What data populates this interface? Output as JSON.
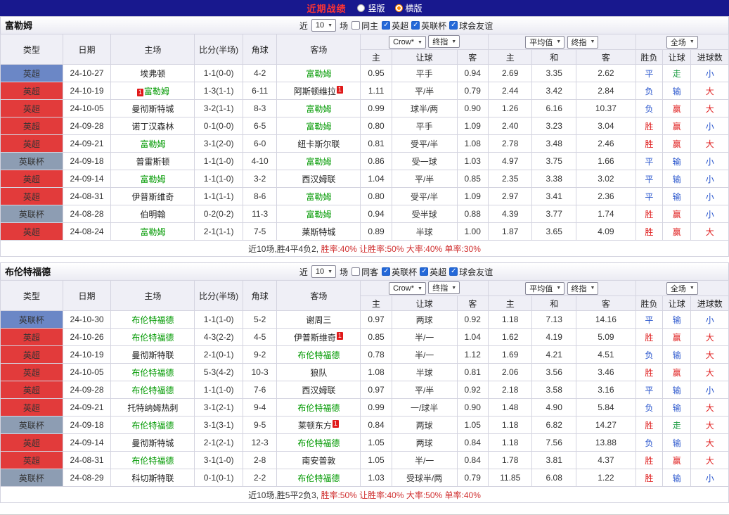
{
  "topbar": {
    "title": "近期战绩",
    "radios": [
      {
        "name": "vertical",
        "label": "竖版",
        "selected": false
      },
      {
        "name": "horizontal",
        "label": "横版",
        "selected": true
      }
    ]
  },
  "icons": {
    "arrow": "▼",
    "check": "✓"
  },
  "colors": {
    "navy_bar": "#18188e",
    "title_red": "#ff3333",
    "league": {
      "recent": "#6b87c6",
      "premier": "#e23b3b",
      "cup": "#8d9db3"
    },
    "result_map": {
      "胜": "#e02222",
      "赢": "#e02222",
      "大": "#e02222",
      "负": "#2653cc",
      "输": "#2653cc",
      "小": "#2653cc",
      "平": "#2653cc",
      "走": "#1f9e45"
    },
    "focus_team": "#009900",
    "score": "#d03a3a",
    "rates": "#d03030"
  },
  "headers": {
    "cols": [
      "类型",
      "日期",
      "主场",
      "比分(半场)",
      "角球",
      "客场"
    ],
    "asian": [
      "主",
      "让球",
      "客"
    ],
    "euro": [
      "主",
      "和",
      "客"
    ],
    "res": [
      "胜负",
      "让球",
      "进球数"
    ]
  },
  "sections": [
    {
      "team": "富勒姆",
      "filters": {
        "recent_label": "近",
        "count": "10",
        "games_label": "场",
        "same_label": "同主",
        "same_checked": false,
        "leagues": [
          {
            "label": "英超",
            "checked": true
          },
          {
            "label": "英联杯",
            "checked": true
          },
          {
            "label": "球会友谊",
            "checked": true
          }
        ]
      },
      "dropdowns": {
        "book": "Crow*",
        "book_time": "终指",
        "avg": "平均值",
        "avg_time": "终指",
        "scope": "全场"
      },
      "rows": [
        {
          "league": "英超",
          "league_color": "recent",
          "date": "24-10-27",
          "home": "埃弗顿",
          "home_focus": false,
          "score": "1-1(0-0)",
          "corners": "4-2",
          "away": "富勒姆",
          "away_focus": true,
          "ah_home": "0.95",
          "ah_line": "平手",
          "ah_away": "0.94",
          "eu_home": "2.69",
          "eu_draw": "3.35",
          "eu_away": "2.62",
          "res_outcome": "平",
          "res_handicap": "走",
          "res_goals": "小"
        },
        {
          "league": "英超",
          "league_color": "premier",
          "date": "24-10-19",
          "home": "富勒姆",
          "home_focus": true,
          "home_card": "1",
          "home_card_pos": "before",
          "score": "1-3(1-1)",
          "corners": "6-11",
          "away": "阿斯顿维拉",
          "away_focus": false,
          "away_card": "1",
          "away_card_pos": "after",
          "ah_home": "1.11",
          "ah_line": "平/半",
          "ah_away": "0.79",
          "eu_home": "2.44",
          "eu_draw": "3.42",
          "eu_away": "2.84",
          "res_outcome": "负",
          "res_handicap": "输",
          "res_goals": "大"
        },
        {
          "league": "英超",
          "league_color": "premier",
          "date": "24-10-05",
          "home": "曼彻斯特城",
          "home_focus": false,
          "score": "3-2(1-1)",
          "corners": "8-3",
          "away": "富勒姆",
          "away_focus": true,
          "ah_home": "0.99",
          "ah_line": "球半/两",
          "ah_away": "0.90",
          "eu_home": "1.26",
          "eu_draw": "6.16",
          "eu_away": "10.37",
          "res_outcome": "负",
          "res_handicap": "赢",
          "res_goals": "大"
        },
        {
          "league": "英超",
          "league_color": "premier",
          "date": "24-09-28",
          "home": "诺丁汉森林",
          "home_focus": false,
          "score": "0-1(0-0)",
          "corners": "6-5",
          "away": "富勒姆",
          "away_focus": true,
          "ah_home": "0.80",
          "ah_line": "平手",
          "ah_away": "1.09",
          "eu_home": "2.40",
          "eu_draw": "3.23",
          "eu_away": "3.04",
          "res_outcome": "胜",
          "res_handicap": "赢",
          "res_goals": "小"
        },
        {
          "league": "英超",
          "league_color": "premier",
          "date": "24-09-21",
          "home": "富勒姆",
          "home_focus": true,
          "score": "3-1(2-0)",
          "corners": "6-0",
          "away": "纽卡斯尔联",
          "away_focus": false,
          "ah_home": "0.81",
          "ah_line": "受平/半",
          "ah_away": "1.08",
          "eu_home": "2.78",
          "eu_draw": "3.48",
          "eu_away": "2.46",
          "res_outcome": "胜",
          "res_handicap": "赢",
          "res_goals": "大"
        },
        {
          "league": "英联杯",
          "league_color": "cup",
          "date": "24-09-18",
          "home": "普雷斯顿",
          "home_focus": false,
          "score": "1-1(1-0)",
          "corners": "4-10",
          "away": "富勒姆",
          "away_focus": true,
          "ah_home": "0.86",
          "ah_line": "受一球",
          "ah_away": "1.03",
          "eu_home": "4.97",
          "eu_draw": "3.75",
          "eu_away": "1.66",
          "res_outcome": "平",
          "res_handicap": "输",
          "res_goals": "小"
        },
        {
          "league": "英超",
          "league_color": "premier",
          "date": "24-09-14",
          "home": "富勒姆",
          "home_focus": true,
          "score": "1-1(1-0)",
          "corners": "3-2",
          "away": "西汉姆联",
          "away_focus": false,
          "ah_home": "1.04",
          "ah_line": "平/半",
          "ah_away": "0.85",
          "eu_home": "2.35",
          "eu_draw": "3.38",
          "eu_away": "3.02",
          "res_outcome": "平",
          "res_handicap": "输",
          "res_goals": "小"
        },
        {
          "league": "英超",
          "league_color": "premier",
          "date": "24-08-31",
          "home": "伊普斯维奇",
          "home_focus": false,
          "score": "1-1(1-1)",
          "corners": "8-6",
          "away": "富勒姆",
          "away_focus": true,
          "ah_home": "0.80",
          "ah_line": "受平/半",
          "ah_away": "1.09",
          "eu_home": "2.97",
          "eu_draw": "3.41",
          "eu_away": "2.36",
          "res_outcome": "平",
          "res_handicap": "输",
          "res_goals": "小"
        },
        {
          "league": "英联杯",
          "league_color": "cup",
          "date": "24-08-28",
          "home": "伯明翰",
          "home_focus": false,
          "score": "0-2(0-2)",
          "corners": "11-3",
          "away": "富勒姆",
          "away_focus": true,
          "ah_home": "0.94",
          "ah_line": "受半球",
          "ah_away": "0.88",
          "eu_home": "4.39",
          "eu_draw": "3.77",
          "eu_away": "1.74",
          "res_outcome": "胜",
          "res_handicap": "赢",
          "res_goals": "小"
        },
        {
          "league": "英超",
          "league_color": "premier",
          "date": "24-08-24",
          "home": "富勒姆",
          "home_focus": true,
          "score": "2-1(1-1)",
          "corners": "7-5",
          "away": "莱斯特城",
          "away_focus": false,
          "ah_home": "0.89",
          "ah_line": "半球",
          "ah_away": "1.00",
          "eu_home": "1.87",
          "eu_draw": "3.65",
          "eu_away": "4.09",
          "res_outcome": "胜",
          "res_handicap": "赢",
          "res_goals": "大"
        }
      ],
      "summary": {
        "prefix": "近10场,胜4平4负2,",
        "rates": " 胜率:40% 让胜率:50% 大率:40% 单率:30%"
      }
    },
    {
      "team": "布伦特福德",
      "filters": {
        "recent_label": "近",
        "count": "10",
        "games_label": "场",
        "same_label": "同客",
        "same_checked": false,
        "leagues": [
          {
            "label": "英联杯",
            "checked": true
          },
          {
            "label": "英超",
            "checked": true
          },
          {
            "label": "球会友谊",
            "checked": true
          }
        ]
      },
      "dropdowns": {
        "book": "Crow*",
        "book_time": "终指",
        "avg": "平均值",
        "avg_time": "终指",
        "scope": "全场"
      },
      "rows": [
        {
          "league": "英联杯",
          "league_color": "recent",
          "date": "24-10-30",
          "home": "布伦特福德",
          "home_focus": true,
          "score": "1-1(1-0)",
          "corners": "5-2",
          "away": "谢周三",
          "away_focus": false,
          "ah_home": "0.97",
          "ah_line": "两球",
          "ah_away": "0.92",
          "eu_home": "1.18",
          "eu_draw": "7.13",
          "eu_away": "14.16",
          "res_outcome": "平",
          "res_handicap": "输",
          "res_goals": "小"
        },
        {
          "league": "英超",
          "league_color": "premier",
          "date": "24-10-26",
          "home": "布伦特福德",
          "home_focus": true,
          "score": "4-3(2-2)",
          "corners": "4-5",
          "away": "伊普斯维奇",
          "away_focus": false,
          "away_card": "1",
          "away_card_pos": "after",
          "ah_home": "0.85",
          "ah_line": "半/一",
          "ah_away": "1.04",
          "eu_home": "1.62",
          "eu_draw": "4.19",
          "eu_away": "5.09",
          "res_outcome": "胜",
          "res_handicap": "赢",
          "res_goals": "大"
        },
        {
          "league": "英超",
          "league_color": "premier",
          "date": "24-10-19",
          "home": "曼彻斯特联",
          "home_focus": false,
          "score": "2-1(0-1)",
          "corners": "9-2",
          "away": "布伦特福德",
          "away_focus": true,
          "ah_home": "0.78",
          "ah_line": "半/一",
          "ah_away": "1.12",
          "eu_home": "1.69",
          "eu_draw": "4.21",
          "eu_away": "4.51",
          "res_outcome": "负",
          "res_handicap": "输",
          "res_goals": "大"
        },
        {
          "league": "英超",
          "league_color": "premier",
          "date": "24-10-05",
          "home": "布伦特福德",
          "home_focus": true,
          "score": "5-3(4-2)",
          "corners": "10-3",
          "away": "狼队",
          "away_focus": false,
          "ah_home": "1.08",
          "ah_line": "半球",
          "ah_away": "0.81",
          "eu_home": "2.06",
          "eu_draw": "3.56",
          "eu_away": "3.46",
          "res_outcome": "胜",
          "res_handicap": "赢",
          "res_goals": "大"
        },
        {
          "league": "英超",
          "league_color": "premier",
          "date": "24-09-28",
          "home": "布伦特福德",
          "home_focus": true,
          "score": "1-1(1-0)",
          "corners": "7-6",
          "away": "西汉姆联",
          "away_focus": false,
          "ah_home": "0.97",
          "ah_line": "平/半",
          "ah_away": "0.92",
          "eu_home": "2.18",
          "eu_draw": "3.58",
          "eu_away": "3.16",
          "res_outcome": "平",
          "res_handicap": "输",
          "res_goals": "小"
        },
        {
          "league": "英超",
          "league_color": "premier",
          "date": "24-09-21",
          "home": "托特纳姆热刺",
          "home_focus": false,
          "score": "3-1(2-1)",
          "corners": "9-4",
          "away": "布伦特福德",
          "away_focus": true,
          "ah_home": "0.99",
          "ah_line": "一/球半",
          "ah_away": "0.90",
          "eu_home": "1.48",
          "eu_draw": "4.90",
          "eu_away": "5.84",
          "res_outcome": "负",
          "res_handicap": "输",
          "res_goals": "大"
        },
        {
          "league": "英联杯",
          "league_color": "cup",
          "date": "24-09-18",
          "home": "布伦特福德",
          "home_focus": true,
          "score": "3-1(3-1)",
          "corners": "9-5",
          "away": "莱顿东方",
          "away_focus": false,
          "away_card": "1",
          "away_card_pos": "after",
          "ah_home": "0.84",
          "ah_line": "两球",
          "ah_away": "1.05",
          "eu_home": "1.18",
          "eu_draw": "6.82",
          "eu_away": "14.27",
          "res_outcome": "胜",
          "res_handicap": "走",
          "res_goals": "大"
        },
        {
          "league": "英超",
          "league_color": "premier",
          "date": "24-09-14",
          "home": "曼彻斯特城",
          "home_focus": false,
          "score": "2-1(2-1)",
          "corners": "12-3",
          "away": "布伦特福德",
          "away_focus": true,
          "ah_home": "1.05",
          "ah_line": "两球",
          "ah_away": "0.84",
          "eu_home": "1.18",
          "eu_draw": "7.56",
          "eu_away": "13.88",
          "res_outcome": "负",
          "res_handicap": "输",
          "res_goals": "大"
        },
        {
          "league": "英超",
          "league_color": "premier",
          "date": "24-08-31",
          "home": "布伦特福德",
          "home_focus": true,
          "score": "3-1(1-0)",
          "corners": "2-8",
          "away": "南安普敦",
          "away_focus": false,
          "ah_home": "1.05",
          "ah_line": "半/一",
          "ah_away": "0.84",
          "eu_home": "1.78",
          "eu_draw": "3.81",
          "eu_away": "4.37",
          "res_outcome": "胜",
          "res_handicap": "赢",
          "res_goals": "大"
        },
        {
          "league": "英联杯",
          "league_color": "cup",
          "date": "24-08-29",
          "home": "科切斯特联",
          "home_focus": false,
          "score": "0-1(0-1)",
          "corners": "2-2",
          "away": "布伦特福德",
          "away_focus": true,
          "ah_home": "1.03",
          "ah_line": "受球半/两",
          "ah_away": "0.79",
          "eu_home": "11.85",
          "eu_draw": "6.08",
          "eu_away": "1.22",
          "res_outcome": "胜",
          "res_handicap": "输",
          "res_goals": "小"
        }
      ],
      "summary": {
        "prefix": "近10场,胜5平2负3,",
        "rates": " 胜率:50% 让胜率:40% 大率:50% 单率:40%"
      }
    }
  ]
}
